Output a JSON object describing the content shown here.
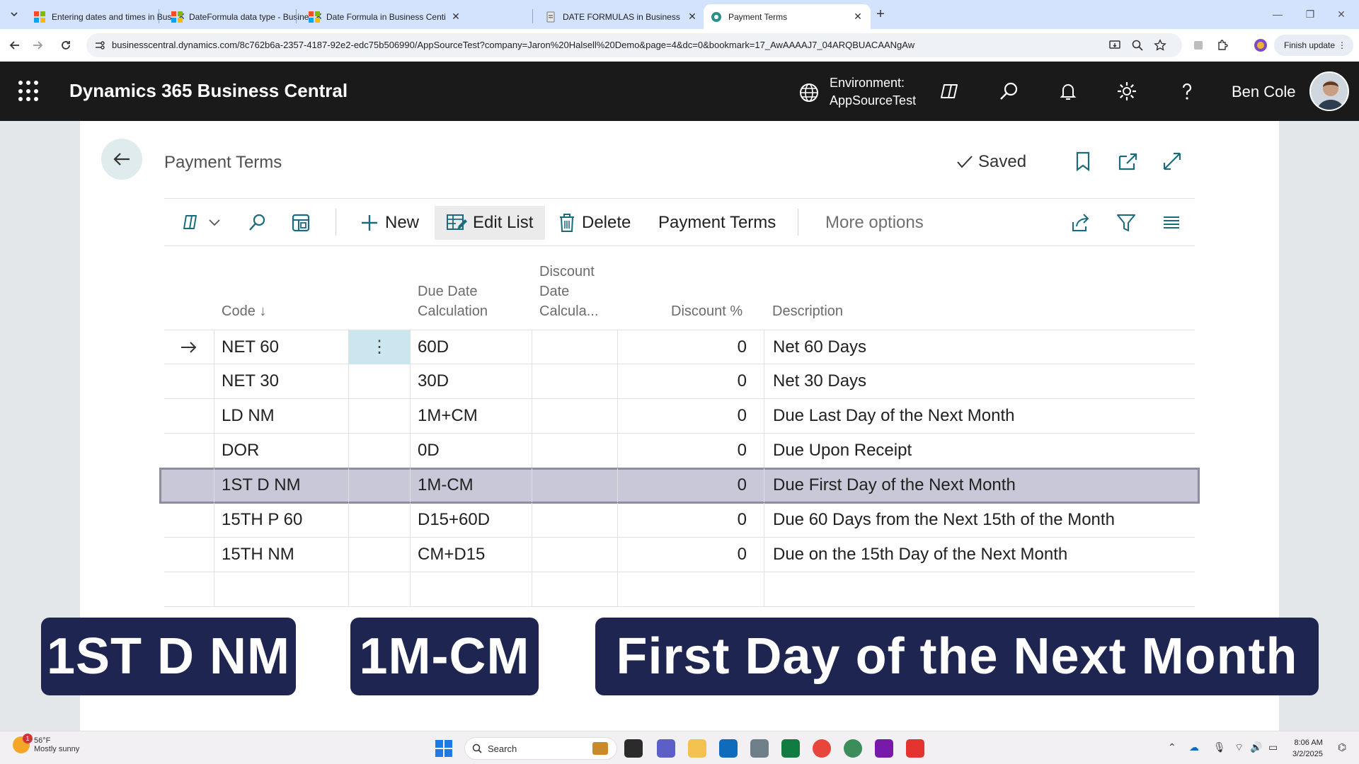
{
  "browser": {
    "tabs": [
      {
        "title": "Entering dates and times in Busi",
        "favicon": "ms-logo-icon"
      },
      {
        "title": "DateFormula data type - Busine",
        "favicon": "ms-logo-icon"
      },
      {
        "title": "Date Formula in Business Centi",
        "favicon": "ms-logo-icon"
      },
      {
        "title": "DATE FORMULAS in Business C",
        "favicon": "doc-icon"
      },
      {
        "title": "Payment Terms",
        "favicon": "globe-icon",
        "active": true
      }
    ],
    "url": "businesscentral.dynamics.com/8c762b6a-2357-4187-92e2-edc75b506990/AppSourceTest?company=Jaron%20Halsell%20Demo&page=4&dc=0&bookmark=17_AwAAAAJ7_04ARQBUACAANgAw",
    "finish_update": "Finish update"
  },
  "header": {
    "app_title": "Dynamics 365 Business Central",
    "environment_label": "Environment:",
    "environment_name": "AppSourceTest",
    "user_name": "Ben Cole"
  },
  "page": {
    "title": "Payment Terms",
    "saved_label": "Saved"
  },
  "actions": {
    "new": "New",
    "edit_list": "Edit List",
    "delete": "Delete",
    "payment_terms": "Payment Terms",
    "more_options": "More options"
  },
  "table": {
    "columns": {
      "code": "Code",
      "code_sort": "↓",
      "due_date_1": "Due Date",
      "due_date_2": "Calculation",
      "disc_date_1": "Discount",
      "disc_date_2": "Date",
      "disc_date_3": "Calcula...",
      "discount_pct": "Discount %",
      "description": "Description"
    },
    "rows": [
      {
        "code": "NET 60",
        "due": "60D",
        "disc_date": "",
        "disc_pct": "0",
        "description": "Net 60 Days"
      },
      {
        "code": "NET 30",
        "due": "30D",
        "disc_date": "",
        "disc_pct": "0",
        "description": "Net 30 Days"
      },
      {
        "code": "LD NM",
        "due": "1M+CM",
        "disc_date": "",
        "disc_pct": "0",
        "description": "Due Last Day of the Next Month"
      },
      {
        "code": "DOR",
        "due": "0D",
        "disc_date": "",
        "disc_pct": "0",
        "description": "Due Upon Receipt"
      },
      {
        "code": "1ST D NM",
        "due": "1M-CM",
        "disc_date": "",
        "disc_pct": "0",
        "description": "Due First Day of the Next Month"
      },
      {
        "code": "15TH P 60",
        "due": "D15+60D",
        "disc_date": "",
        "disc_pct": "0",
        "description": "Due 60 Days from the Next 15th of the Month"
      },
      {
        "code": "15TH NM",
        "due": "CM+D15",
        "disc_date": "",
        "disc_pct": "0",
        "description": "Due on the 15th Day of the Next Month"
      }
    ],
    "selected_row_index": 4
  },
  "captions": {
    "code": "1ST D NM",
    "formula": "1M-CM",
    "meaning": "First Day of the Next Month"
  },
  "taskbar": {
    "temp": "56°F",
    "weather": "Mostly sunny",
    "weather_badge": "1",
    "search": "Search",
    "time": "8:06 AM",
    "date": "3/2/2025"
  },
  "colors": {
    "header_bg": "#1a1a1a",
    "caption_bg": "#1f2551",
    "selected_row": "#c9c8d8",
    "tab_strip": "#d3e3fd"
  }
}
